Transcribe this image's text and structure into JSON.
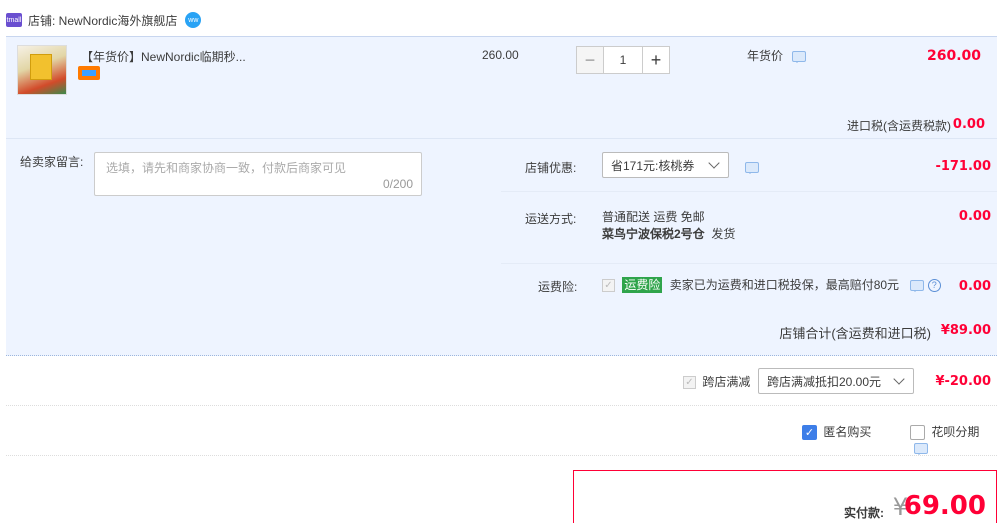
{
  "shop": {
    "label": "店铺: NewNordic海外旗舰店"
  },
  "item": {
    "title": "【年货价】NewNordic临期秒...",
    "unit_price": "260.00",
    "quantity": "1",
    "minus": "−",
    "plus": "+",
    "promo_label": "年货价",
    "subtotal": "260.00",
    "tax_label": "进口税(含运费税款)",
    "tax_value": "0.00"
  },
  "message": {
    "label": "给卖家留言:",
    "placeholder": "选填，请先和商家协商一致，付款后商家可见",
    "count": "0/200"
  },
  "shop_discount": {
    "label": "店铺优惠:",
    "selected": "省171元:核桃券",
    "value": "-171.00"
  },
  "shipping": {
    "label": "运送方式:",
    "method": "普通配送 运费 免邮",
    "origin": "菜鸟宁波保税2号仓",
    "origin_suffix": "发货",
    "value": "0.00"
  },
  "insurance": {
    "label": "运费险:",
    "tag": "运费险",
    "text": "卖家已为运费和进口税投保，最高赔付80元",
    "help": "?",
    "value": "0.00"
  },
  "shop_total": {
    "label": "店铺合计(含运费和进口税)",
    "value": "¥89.00"
  },
  "cross_store": {
    "label": "跨店满减",
    "selected": "跨店满减抵扣20.00元",
    "value": "¥-20.00"
  },
  "options": {
    "anonymous": "匿名购买",
    "huabei": "花呗分期"
  },
  "payment": {
    "label": "实付款:",
    "currency": "¥",
    "amount": "69.00"
  },
  "icons": {
    "check": "✓",
    "shop_icon_text": "tmall",
    "ww_text": "ww"
  },
  "colors": {
    "accent_red": "#ff0036",
    "row_blue": "#eef4ff",
    "checkbox_blue": "#3d7ee8",
    "tag_green": "#2fa44b"
  }
}
